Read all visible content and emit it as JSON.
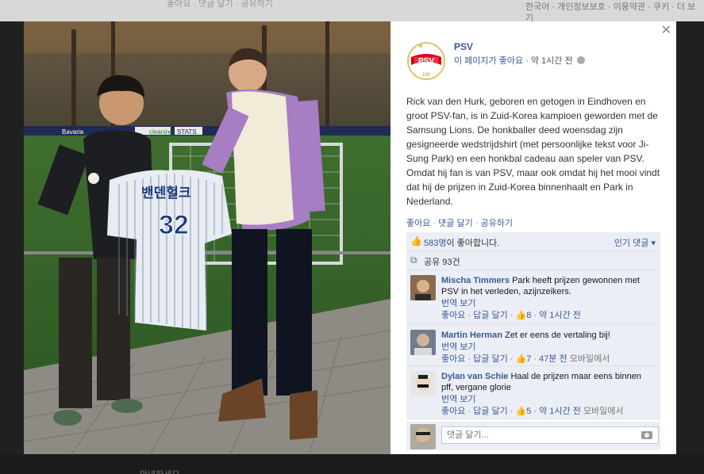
{
  "background": {
    "top_text": "좋아요 · 댓글 달기 · 공유하기",
    "top_right_links": "한국어 · 개인정보보호 · 이용약관 · 쿠키 · 더 보기",
    "bottom_text": "안녕하세요"
  },
  "post": {
    "page_name": "PSV",
    "like_page": "이 페이지가 좋아요",
    "time": "약 1시간 전",
    "body": "Rick van den Hurk, geboren en getogen in Eindhoven en groot PSV-fan, is in Zuid-Korea kampioen geworden met de Samsung Lions. De honkballer deed woensdag zijn gesigneerde wedstrijdshirt (met persoonlijke tekst voor Ji-Sung Park) en een honkbal cadeau aan speler van PSV. Omdat hij fan is van PSV, maar ook omdat hij het mooi vindt dat hij de prijzen in Zuid-Korea binnenhaalt en Park in Nederland.",
    "actions": {
      "like": "좋아요",
      "comment": "댓글 달기",
      "share": "공유하기"
    }
  },
  "ufi": {
    "likes_count": "583명",
    "likes_text": "이 좋아합니다.",
    "sort_label": "인기 댓글",
    "shares_text": "공유 93건"
  },
  "comments": [
    {
      "name": "Mischa Timmers",
      "text": "Park heeft prijzen gewonnen met PSV in het verleden, azijnzeikers.",
      "translate": "번역 보기",
      "like": "좋아요",
      "reply": "답글 달기",
      "likes": "8",
      "time": "약 1시간 전",
      "device": ""
    },
    {
      "name": "Martin Herman",
      "text": "Zet er eens de vertaling bij!",
      "translate": "번역 보기",
      "like": "좋아요",
      "reply": "답글 달기",
      "likes": "7",
      "time": "47분 전",
      "device": "모바일에서"
    },
    {
      "name": "Dylan van Schie",
      "text": "Haal de prijzen maar eens binnen pff, vergane glorie",
      "translate": "번역 보기",
      "like": "좋아요",
      "reply": "답글 달기",
      "likes": "5",
      "time": "약 1시간 전",
      "device": "모바일에서"
    }
  ],
  "reply_box": {
    "placeholder": "댓글 달기..."
  },
  "photo": {
    "jersey_name": "밴덴헐크",
    "jersey_number": "32",
    "ad_boards": [
      "Bavaria",
      "cleaning",
      "STATS"
    ]
  },
  "logo": {
    "text": "PSV",
    "years": "100"
  },
  "colors": {
    "link": "#3b5998",
    "ufi_bg": "#eceef5",
    "psv_red": "#e2001a"
  },
  "icons": {
    "close": "close-icon",
    "globe": "globe-icon",
    "like": "thumbs-up-icon",
    "share": "share-icon",
    "camera": "camera-icon"
  }
}
